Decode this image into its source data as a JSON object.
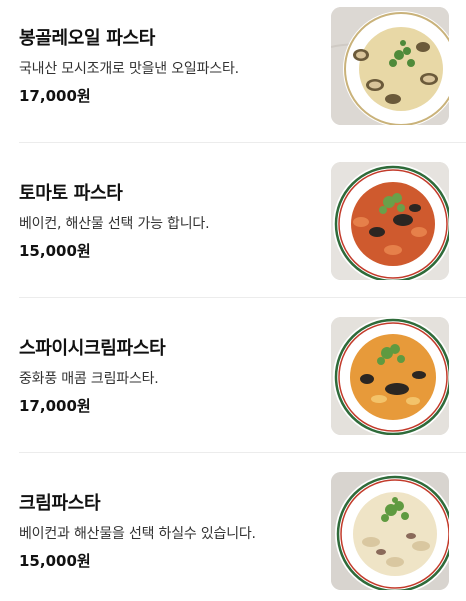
{
  "menu": {
    "items": [
      {
        "name": "봉골레오일 파스타",
        "description": "국내산 모시조개로 맛을낸 오일파스타.",
        "price": "17,000원",
        "image_icon": "vongole-pasta-photo",
        "sauce_color": "#e7d7a8"
      },
      {
        "name": "토마토 파스타",
        "description": "베이컨, 해산물 선택 가능 합니다.",
        "price": "15,000원",
        "image_icon": "tomato-pasta-photo",
        "sauce_color": "#d2552c"
      },
      {
        "name": "스파이시크림파스타",
        "description": "중화풍 매콤 크림파스타.",
        "price": "17,000원",
        "image_icon": "spicy-cream-pasta-photo",
        "sauce_color": "#e59a3a"
      },
      {
        "name": "크림파스타",
        "description": "베이컨과 해산물을 선택 하실수 있습니다.",
        "price": "15,000원",
        "image_icon": "cream-pasta-photo",
        "sauce_color": "#efe6cf"
      }
    ]
  }
}
